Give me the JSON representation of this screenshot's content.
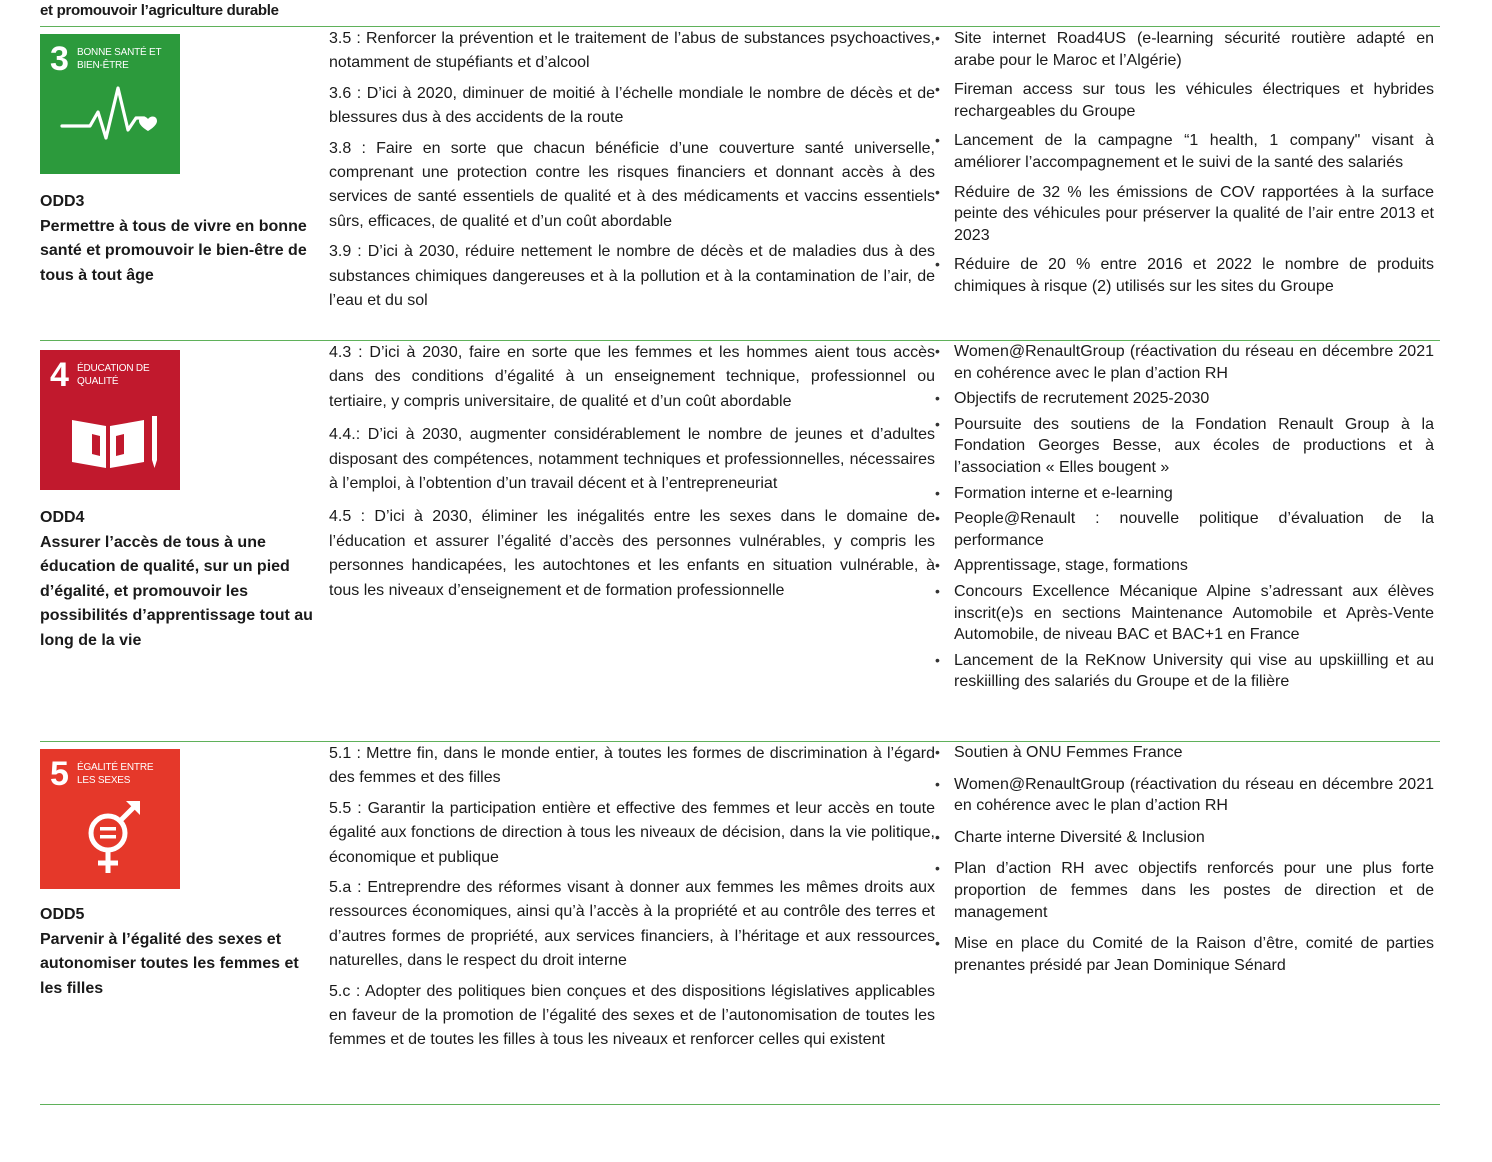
{
  "top_caption": "et promouvoir l’agriculture durable",
  "colors": {
    "rule": "#5fb15a",
    "odd3": "#2c9a3c",
    "odd4": "#c1192d",
    "odd5": "#e5382a"
  },
  "rows": [
    {
      "tile_number": "3",
      "tile_label": "BONNE SANTÉ ET BIEN-ÊTRE",
      "tile_icon": "heartbeat-icon",
      "code": "ODD3",
      "title": "Permettre à tous de vivre en bonne santé et promouvoir le bien-être de tous à tout âge",
      "targets": [
        "3.5 : Renforcer la prévention et le traitement de l’abus de substances psychoactives, notamment de stupéfiants et d’alcool",
        "3.6 : D’ici à 2020, diminuer de moitié à l’échelle mondiale le nombre de décès et de blessures dus à des accidents de la route",
        "3.8 : Faire en sorte que chacun bénéficie d’une couverture santé universelle, comprenant une protection contre les risques financiers et donnant accès à des services de santé essentiels de qualité et à des médicaments et vaccins essentiels sûrs, efficaces, de qualité et d’un coût abordable",
        "3.9 : D’ici à 2030, réduire nettement le nombre de décès et de maladies dus à des substances chimiques dangereuses et à la pollution et à la contamination de l’air, de l’eau et du sol"
      ],
      "actions": [
        "Site internet Road4US (e-learning sécurité routière adapté en arabe pour le Maroc et l’Algérie)",
        "Fireman access sur tous les véhicules électriques et hybrides rechargeables du Groupe",
        "Lancement de la campagne “1 health, 1 company\" visant à améliorer l’accompagnement et le suivi de la santé des salariés",
        "Réduire de 32 % les émissions de COV rapportées à la surface peinte des véhicules pour préserver la qualité de l’air entre 2013 et 2023",
        "Réduire de 20 % entre 2016 et 2022 le nombre de produits chimiques à risque (2) utilisés sur les sites du Groupe"
      ]
    },
    {
      "tile_number": "4",
      "tile_label": "ÉDUCATION DE QUALITÉ",
      "tile_icon": "book-pencil-icon",
      "code": "ODD4",
      "title": "Assurer l’accès de tous à une éducation de qualité, sur un pied d’égalité, et promouvoir les possibilités d’apprentissage tout au long de la vie",
      "targets": [
        "4.3 : D’ici à 2030, faire en sorte que les femmes et les hommes aient tous accès dans des conditions d’égalité à un enseignement technique, professionnel ou tertiaire, y compris universitaire, de qualité et d’un coût abordable",
        "4.4.: D’ici à 2030, augmenter considérablement le nombre de jeunes et d’adultes disposant des compétences, notamment techniques et professionnelles, nécessaires à l’emploi, à l’obtention d’un travail décent et à l’entrepreneuriat",
        "4.5 : D’ici à 2030, éliminer les inégalités entre les sexes dans le domaine de l’éducation et assurer l’égalité d’accès des personnes vulnérables, y compris les personnes handicapées, les autochtones et les enfants en situation vulnérable, à tous les niveaux d’enseignement et de formation professionnelle"
      ],
      "actions": [
        "Women@RenaultGroup (réactivation du réseau en décembre 2021 en cohérence avec le plan d’action RH",
        "Objectifs de recrutement 2025-2030",
        "Poursuite des soutiens de la Fondation Renault Group à la Fondation Georges Besse, aux écoles de productions et à l’association « Elles bougent »",
        "Formation interne et e-learning",
        "People@Renault : nouvelle politique d’évaluation de la performance",
        "Apprentissage, stage, formations",
        "Concours Excellence Mécanique Alpine s’adressant aux élèves inscrit(e)s en sections Maintenance Automobile et Après-Vente Automobile, de niveau BAC et BAC+1 en France",
        "Lancement de la ReKnow University qui vise au upskiilling et au reskiilling des salariés du Groupe et de la filière"
      ]
    },
    {
      "tile_number": "5",
      "tile_label": "ÉGALITÉ ENTRE LES SEXES",
      "tile_icon": "gender-equality-icon",
      "code": "ODD5",
      "title": "Parvenir à l’égalité des sexes et autonomiser toutes les femmes et les filles",
      "targets": [
        "5.1 : Mettre fin, dans le monde entier, à toutes les formes de discrimination à l’égard des femmes et des filles",
        "5.5 : Garantir la participation entière et effective des femmes et leur accès en toute égalité aux fonctions de direction à tous les niveaux de décision, dans la vie politique, économique et publique",
        "5.a : Entreprendre des réformes visant à donner aux femmes les mêmes droits aux ressources économiques, ainsi qu’à l’accès à la propriété et au contrôle des terres et d’autres formes de propriété, aux services financiers, à l’héritage et aux ressources naturelles, dans le respect du droit interne",
        "5.c : Adopter des politiques bien conçues et des dispositions législatives applicables en faveur de la promotion de l’égalité des sexes et de l’autonomisation de toutes les femmes et de toutes les filles à tous les niveaux et renforcer celles qui existent"
      ],
      "actions": [
        "Soutien à ONU Femmes France",
        "Women@RenaultGroup (réactivation du réseau en décembre 2021 en cohérence avec le plan d’action RH",
        "Charte interne Diversité & Inclusion",
        "Plan d’action RH avec objectifs renforcés pour une plus forte proportion de femmes dans les postes de direction et de management",
        "Mise en place du Comité de la Raison d’être, comité de parties prenantes présidé par Jean Dominique Sénard"
      ]
    }
  ]
}
